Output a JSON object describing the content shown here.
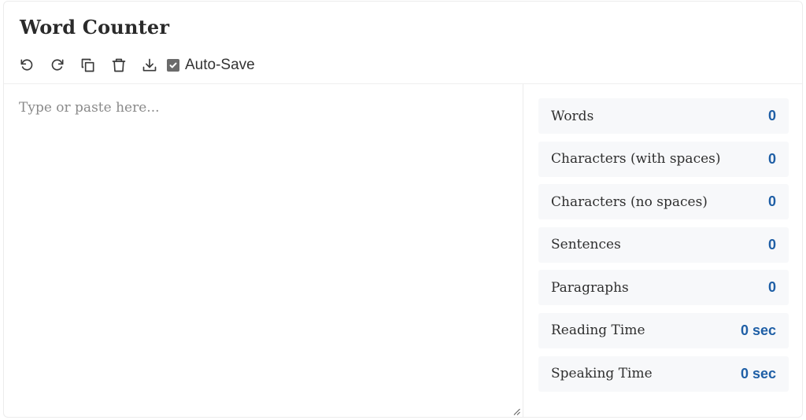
{
  "app": {
    "title": "Word Counter"
  },
  "toolbar": {
    "icons": [
      "undo-icon",
      "redo-icon",
      "copy-icon",
      "trash-icon",
      "download-icon"
    ],
    "autosave_label": "Auto-Save",
    "autosave_checked": true
  },
  "editor": {
    "placeholder": "Type or paste here...",
    "value": ""
  },
  "stats": [
    {
      "label": "Words",
      "value": "0"
    },
    {
      "label": "Characters (with spaces)",
      "value": "0"
    },
    {
      "label": "Characters (no spaces)",
      "value": "0"
    },
    {
      "label": "Sentences",
      "value": "0"
    },
    {
      "label": "Paragraphs",
      "value": "0"
    },
    {
      "label": "Reading Time",
      "value": "0 sec"
    },
    {
      "label": "Speaking Time",
      "value": "0 sec"
    }
  ],
  "colors": {
    "accent": "#1f5fa6",
    "stat_background": "#f7f8fa",
    "checkbox": "#6b6b6b"
  }
}
